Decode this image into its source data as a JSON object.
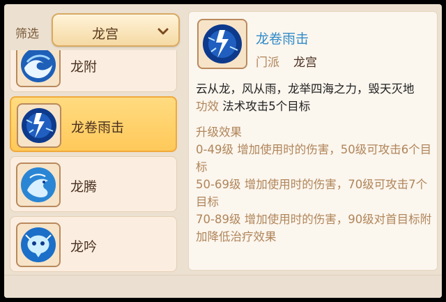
{
  "filter": {
    "label": "筛选",
    "selected": "龙宫",
    "chevron_icon": "chevron-down-icon"
  },
  "skills": [
    {
      "name": "龙附",
      "icon": "wave-icon",
      "selected": false
    },
    {
      "name": "龙卷雨击",
      "icon": "lightning-storm-icon",
      "selected": true
    },
    {
      "name": "龙腾",
      "icon": "dragon-icon",
      "selected": false
    },
    {
      "name": "龙吟",
      "icon": "dragon-head-icon",
      "selected": false
    }
  ],
  "detail": {
    "title": "龙卷雨击",
    "sect_label": "门派",
    "sect_value": "龙宫",
    "description": "云从龙，风从雨，龙举四海之力，毁天灭地",
    "effect_label": "功效",
    "effect_value": "法术攻击5个目标",
    "upgrade_title": "升级效果",
    "upgrade_lines": [
      "0-49级 增加使用时的伤害，50级可攻击6个目标",
      "50-69级 增加使用时的伤害，70级可攻击7个目标",
      "70-89级 增加使用时的伤害，90级对首目标附加降低治疗效果"
    ]
  },
  "colors": {
    "title_blue": "#2f8ac8",
    "label_tan": "#b0855a",
    "selected_gold": "#ffc95a"
  }
}
